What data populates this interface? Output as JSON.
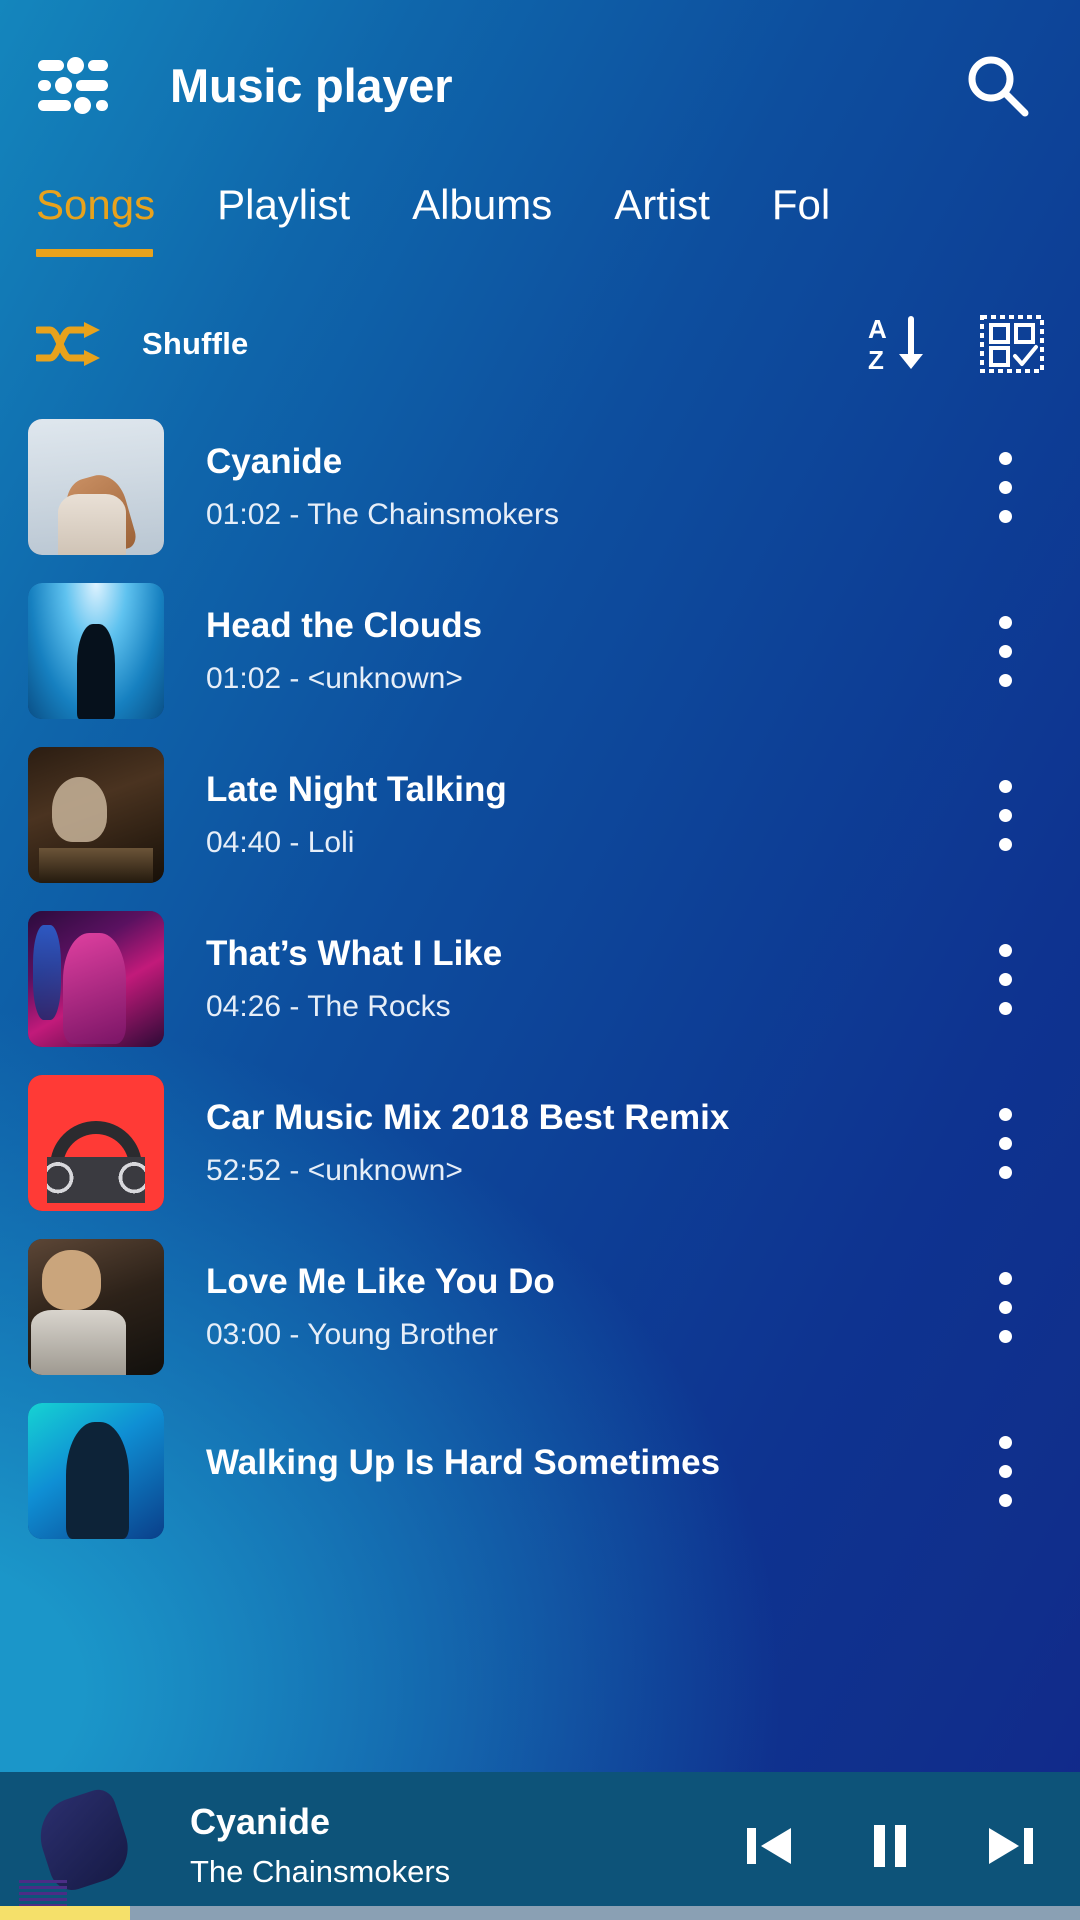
{
  "header": {
    "menu_icon": "equalizer-icon",
    "title": "Music player",
    "search_icon": "search-icon"
  },
  "tabs": {
    "active_index": 0,
    "items": [
      {
        "label": "Songs"
      },
      {
        "label": "Playlist"
      },
      {
        "label": "Albums"
      },
      {
        "label": "Artist"
      },
      {
        "label": "Fol"
      }
    ]
  },
  "toolbar": {
    "shuffle_icon": "shuffle-icon",
    "shuffle_label": "Shuffle",
    "sort_icon": "sort-az-descending-icon",
    "sort_letters": {
      "top": "A",
      "bottom": "Z"
    },
    "select_icon": "multi-select-icon"
  },
  "songs": [
    {
      "title": "Cyanide",
      "subtitle": "01:02 - The Chainsmokers",
      "duration": "01:02",
      "artist": "The Chainsmokers",
      "art": "a1"
    },
    {
      "title": "Head the Clouds",
      "subtitle": "01:02 - <unknown>",
      "duration": "01:02",
      "artist": "<unknown>",
      "art": "a2"
    },
    {
      "title": "Late Night Talking",
      "subtitle": "04:40 - Loli",
      "duration": "04:40",
      "artist": "Loli",
      "art": "a3"
    },
    {
      "title": "That’s What I Like",
      "subtitle": "04:26 - The Rocks",
      "duration": "04:26",
      "artist": "The Rocks",
      "art": "a4"
    },
    {
      "title": "Car Music Mix 2018 Best Remix",
      "subtitle": "52:52 - <unknown>",
      "duration": "52:52",
      "artist": "<unknown>",
      "art": "a5"
    },
    {
      "title": "Love Me Like You Do",
      "subtitle": "03:00 - Young Brother",
      "duration": "03:00",
      "artist": "Young Brother",
      "art": "a6"
    },
    {
      "title": "Walking Up Is Hard Sometimes",
      "subtitle": "",
      "duration": "",
      "artist": "",
      "art": "a7"
    }
  ],
  "now_playing": {
    "title": "Cyanide",
    "artist": "The Chainsmokers",
    "previous_icon": "skip-previous-icon",
    "play_pause_icon": "pause-icon",
    "next_icon": "skip-next-icon",
    "progress_percent": 12
  },
  "colors": {
    "accent": "#e8a21c",
    "progress_fill": "#f5e06a",
    "progress_track": "#8aa0b4",
    "now_playing_bg": "#0d5379",
    "background_start": "#1486bd",
    "background_end": "#12288a"
  }
}
